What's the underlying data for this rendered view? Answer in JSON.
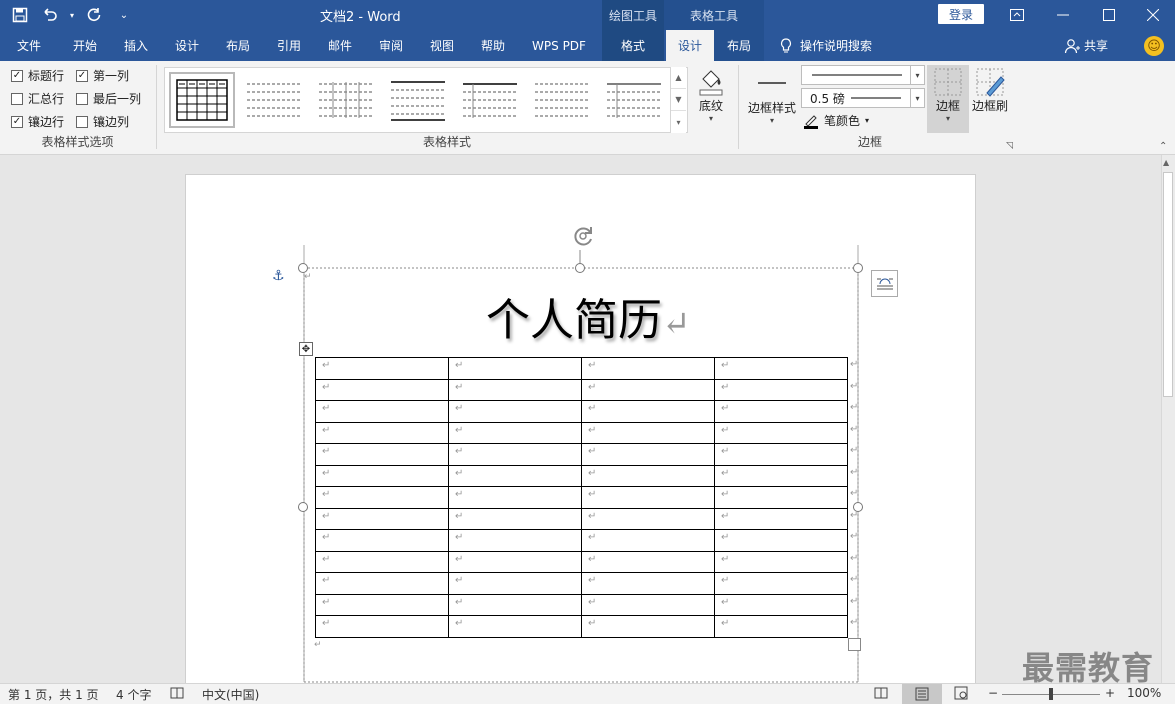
{
  "titlebar": {
    "doc_title": "文档2  -  Word",
    "tool_draw": "绘图工具",
    "tool_table": "表格工具",
    "login": "登录"
  },
  "tabs": [
    {
      "label": "文件"
    },
    {
      "label": "开始"
    },
    {
      "label": "插入"
    },
    {
      "label": "设计"
    },
    {
      "label": "布局"
    },
    {
      "label": "引用"
    },
    {
      "label": "邮件"
    },
    {
      "label": "审阅"
    },
    {
      "label": "视图"
    },
    {
      "label": "帮助"
    },
    {
      "label": "WPS PDF"
    },
    {
      "label": "格式"
    },
    {
      "label": "设计"
    },
    {
      "label": "布局"
    }
  ],
  "search_label": "操作说明搜索",
  "share_label": "共享",
  "style_options": {
    "header_row": "标题行",
    "first_col": "第一列",
    "total_row": "汇总行",
    "last_col": "最后一列",
    "banded_rows": "镶边行",
    "banded_cols": "镶边列",
    "group_label": "表格样式选项",
    "check_mark": "✓"
  },
  "table_styles": {
    "group_label": "表格样式",
    "shading": "底纹"
  },
  "borders": {
    "border_styles": "边框样式",
    "weight": "0.5 磅",
    "pen_color": "笔颜色",
    "border": "边框",
    "border_painter": "边框刷",
    "group_label": "边框"
  },
  "document": {
    "heading": "个人简历",
    "return_mark": "↵",
    "rows": 13,
    "cols": 4
  },
  "status": {
    "page": "第 1 页，共 1 页",
    "words": "4 个字",
    "lang": "中文(中国)",
    "zoom": "100%"
  },
  "watermark": "最需教育",
  "colors": {
    "accent": "#2b579a",
    "ribbon_bg": "#f3f3f3"
  }
}
